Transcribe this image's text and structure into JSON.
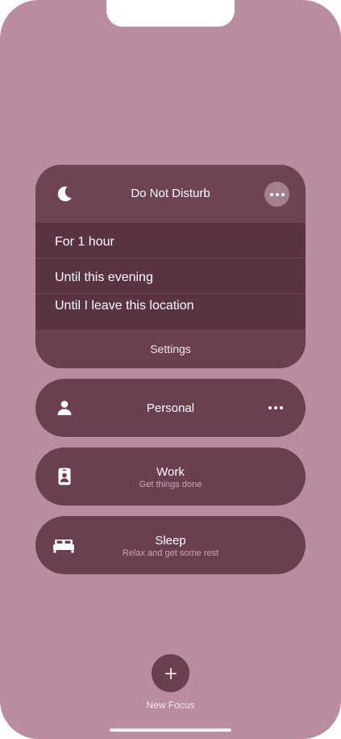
{
  "dnd": {
    "title": "Do Not Disturb",
    "icon": "moon-icon",
    "options": [
      {
        "label": "For 1 hour"
      },
      {
        "label": "Until this evening"
      },
      {
        "label": "Until I leave this location"
      }
    ],
    "settings_label": "Settings"
  },
  "focus_modes": [
    {
      "title": "Personal",
      "subtitle": "",
      "icon": "person-icon"
    },
    {
      "title": "Work",
      "subtitle": "Get things done",
      "icon": "id-badge-icon"
    },
    {
      "title": "Sleep",
      "subtitle": "Relax and get some rest",
      "icon": "bed-icon"
    }
  ],
  "new_focus": {
    "label": "New Focus",
    "icon": "plus-icon"
  },
  "colors": {
    "background": "#b98c9f",
    "card": "#6a3f50",
    "options_panel": "#5a3343",
    "accent_circle": "#a3808e"
  }
}
